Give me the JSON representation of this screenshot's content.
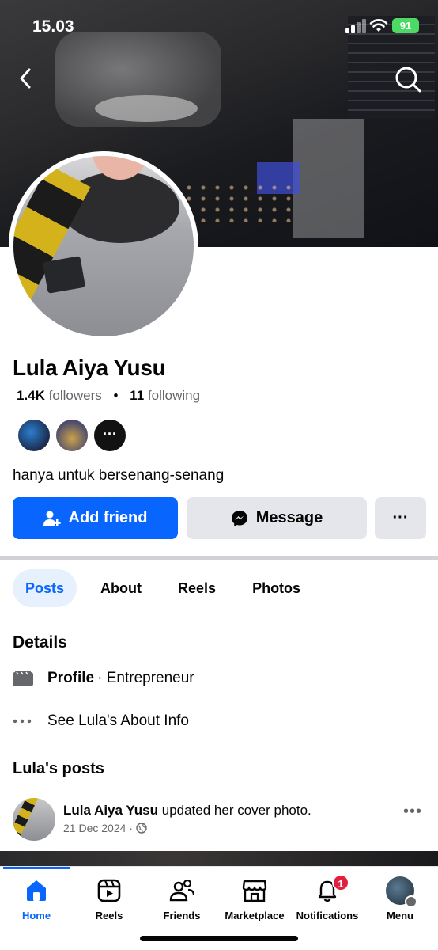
{
  "status_bar": {
    "time": "15.03",
    "battery": "91"
  },
  "profile": {
    "name": "Lula Aiya Yusu",
    "followers_count": "1.4K",
    "followers_label": "followers",
    "following_count": "11",
    "following_label": "following",
    "bio": "hanya untuk bersenang-senang",
    "mutual_more": "···"
  },
  "actions": {
    "add_friend": "Add friend",
    "message": "Message",
    "more": "···"
  },
  "tabs": [
    {
      "label": "Posts",
      "active": true
    },
    {
      "label": "About",
      "active": false
    },
    {
      "label": "Reels",
      "active": false
    },
    {
      "label": "Photos",
      "active": false
    }
  ],
  "details": {
    "heading": "Details",
    "profile_type_label": "Profile",
    "profile_type_value": "· Entrepreneur",
    "about_link": "See Lula's About Info"
  },
  "posts": {
    "heading": "Lula's posts",
    "items": [
      {
        "author": "Lula Aiya Yusu",
        "action": "updated her cover photo.",
        "date": "21 Dec 2024 ·"
      }
    ]
  },
  "nav": {
    "items": [
      {
        "label": "Home",
        "icon": "home-icon",
        "active": true
      },
      {
        "label": "Reels",
        "icon": "reels-icon",
        "active": false
      },
      {
        "label": "Friends",
        "icon": "friends-icon",
        "active": false
      },
      {
        "label": "Marketplace",
        "icon": "marketplace-icon",
        "active": false
      },
      {
        "label": "Notifications",
        "icon": "bell-icon",
        "active": false,
        "badge": "1"
      },
      {
        "label": "Menu",
        "icon": "menu-avatar",
        "active": false
      }
    ]
  },
  "colors": {
    "accent": "#0866ff",
    "badge": "#e41e3f"
  }
}
